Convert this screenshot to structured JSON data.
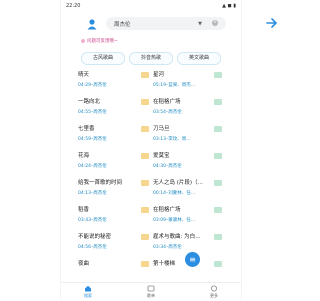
{
  "status": {
    "time": "22:20",
    "icons": "▲ ◼ ▮"
  },
  "search": {
    "value": "周杰伦",
    "caret": "▼",
    "clear": "×"
  },
  "notice": "问题可反馈哦~",
  "tabs": [
    "古风歌曲",
    "抖音热歌",
    "英文歌曲"
  ],
  "songs_left": [
    {
      "title": "晴天",
      "meta": "04:29–周杰伦"
    },
    {
      "title": "一路向北",
      "meta": "04:55–周杰伦"
    },
    {
      "title": "七里香",
      "meta": "04:59–周杰伦"
    },
    {
      "title": "花海",
      "meta": "04:24–周杰伦"
    },
    {
      "title": "给我一首歌的时间",
      "meta": "04:13–周杰伦"
    },
    {
      "title": "稻香",
      "meta": "03:43–周杰伦"
    },
    {
      "title": "不能说的秘密",
      "meta": "04:56–周杰伦"
    },
    {
      "title": "夜曲",
      "meta": ""
    }
  ],
  "songs_right": [
    {
      "title": "星河",
      "meta": "05:19–蓝果、周杰…"
    },
    {
      "title": "在稻格广场",
      "meta": "03:54–周杰伦"
    },
    {
      "title": "刀马旦",
      "meta": "03:13–李玟、周…"
    },
    {
      "title": "爱莫宝",
      "meta": "04:30–周杰伦"
    },
    {
      "title": "无人之岛 (片段)（…",
      "meta": "00:14–刘蒙林、任…"
    },
    {
      "title": "在稻格广场",
      "meta": "03:09–蒙骏林、任…"
    },
    {
      "title": "雇术与歌曲: 为白…",
      "meta": "03:34–周杰伦"
    },
    {
      "title": "第十楼梯",
      "meta": ""
    }
  ],
  "fab_icon": "≡",
  "nav": [
    {
      "label": "搜索"
    },
    {
      "label": "歌单"
    },
    {
      "label": "更多"
    }
  ],
  "colors": {
    "accent": "#2b8ee0",
    "meta": "#1e8bc3",
    "notice": "#d0478f"
  }
}
